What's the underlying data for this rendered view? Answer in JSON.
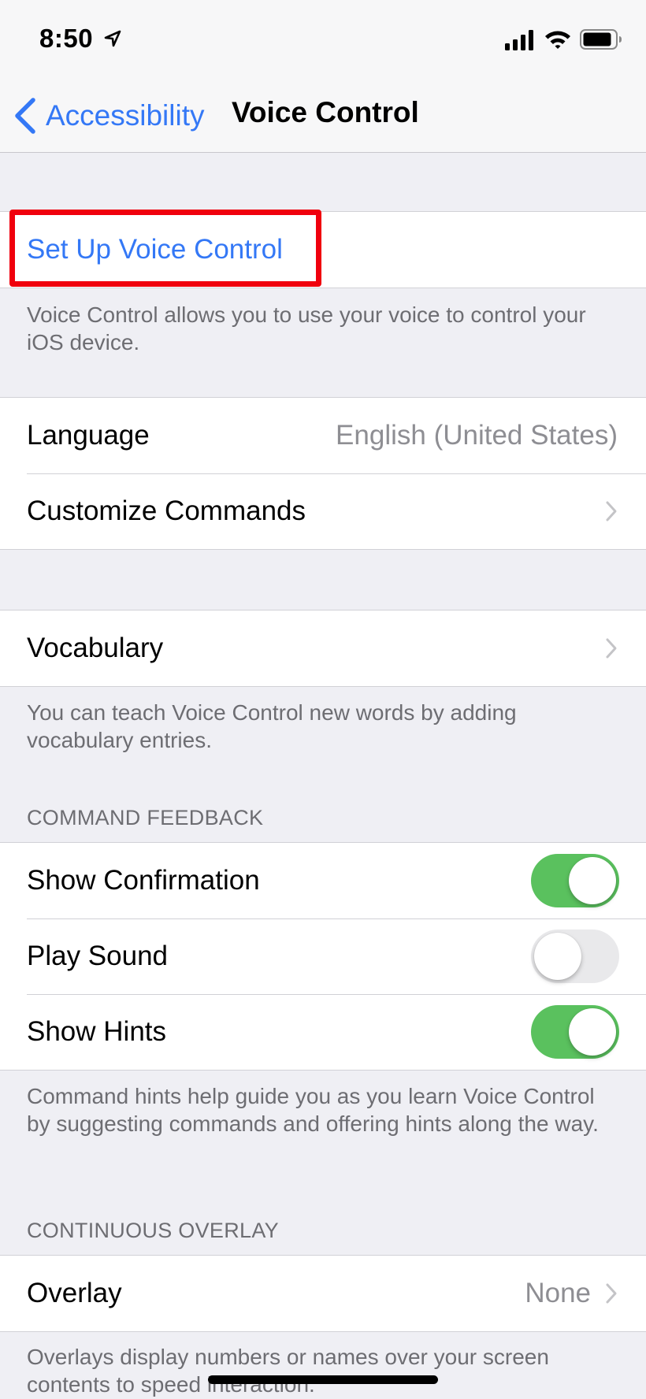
{
  "status": {
    "time": "8:50"
  },
  "nav": {
    "back_label": "Accessibility",
    "title": "Voice Control"
  },
  "setup": {
    "link": "Set Up Voice Control",
    "footer": "Voice Control allows you to use your voice to control your iOS device."
  },
  "group1": {
    "language_label": "Language",
    "language_value": "English (United States)",
    "customize_label": "Customize Commands"
  },
  "vocabulary": {
    "label": "Vocabulary",
    "footer": "You can teach Voice Control new words by adding vocabulary entries."
  },
  "command_feedback": {
    "header": "COMMAND FEEDBACK",
    "items": [
      {
        "label": "Show Confirmation",
        "on": true
      },
      {
        "label": "Play Sound",
        "on": false
      },
      {
        "label": "Show Hints",
        "on": true
      }
    ],
    "footer": "Command hints help guide you as you learn Voice Control by suggesting commands and offering hints along the way."
  },
  "continuous_overlay": {
    "header": "CONTINUOUS OVERLAY",
    "overlay_label": "Overlay",
    "overlay_value": "None",
    "footer": "Overlays display numbers or names over your screen contents to speed interaction."
  },
  "colors": {
    "accent": "#3478f6",
    "toggle_on": "#5ac15e",
    "highlight": "#f0000d"
  }
}
